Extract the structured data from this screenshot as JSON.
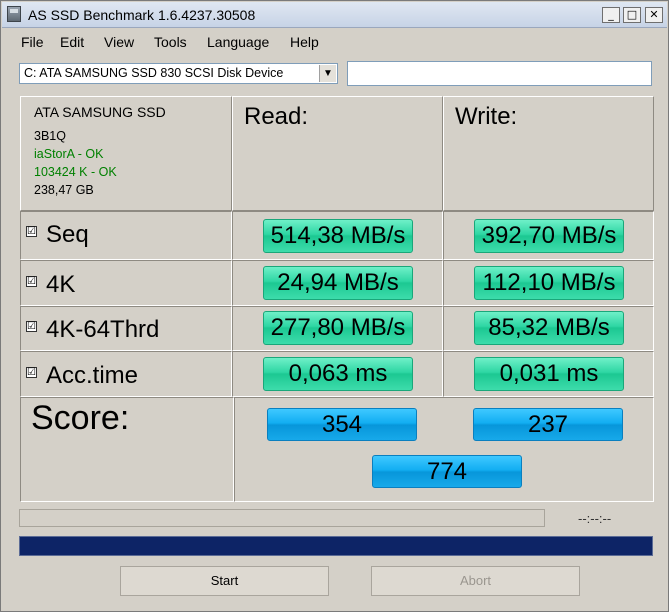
{
  "window": {
    "title": "AS SSD Benchmark 1.6.4237.30508",
    "controls": {
      "minimize": "_",
      "maximize": "□",
      "close": "✕"
    }
  },
  "menu": [
    "File",
    "Edit",
    "View",
    "Tools",
    "Language",
    "Help"
  ],
  "drive_selector": {
    "value": "C: ATA SAMSUNG SSD 830 SCSI Disk Device",
    "arrow": "▼"
  },
  "drive_info": {
    "name": "ATA SAMSUNG SSD",
    "firmware": "3B1Q",
    "driver": "iaStorA - OK",
    "alignment": "103424 K - OK",
    "size": "238,47 GB",
    "status_color": "#008000"
  },
  "columns": {
    "read": "Read:",
    "write": "Write:"
  },
  "tests": [
    {
      "name": "Seq",
      "checked": "☑",
      "read": "514,38 MB/s",
      "write": "392,70 MB/s"
    },
    {
      "name": "4K",
      "checked": "☑",
      "read": "24,94 MB/s",
      "write": "112,10 MB/s"
    },
    {
      "name": "4K-64Thrd",
      "checked": "☑",
      "read": "277,80 MB/s",
      "write": "85,32 MB/s"
    },
    {
      "name": "Acc.time",
      "checked": "☑",
      "read": "0,063 ms",
      "write": "0,031 ms"
    }
  ],
  "score": {
    "label": "Score:",
    "read": "354",
    "write": "237",
    "total": "774"
  },
  "progress": {
    "timer": "--:--:--",
    "fill": 1.0
  },
  "buttons": {
    "start": "Start",
    "abort": "Abort"
  },
  "colors": {
    "result_green": "#2ed6a3",
    "score_blue": "#12aef2",
    "progress": "#0d2466"
  }
}
